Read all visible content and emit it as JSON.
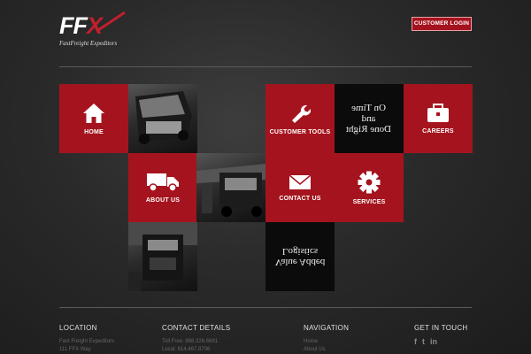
{
  "brand": {
    "logo_text": "FF",
    "logo_x": "X",
    "tagline": "FastFreight Expeditors"
  },
  "header": {
    "login_label": "CUSTOMER LOGIN"
  },
  "tiles": {
    "home": "HOME",
    "customer_tools": "CUSTOMER TOOLS",
    "careers": "CAREERS",
    "about_us": "ABOUT US",
    "contact_us": "CONTACT US",
    "services": "SERVICES",
    "done_right": [
      "On Time",
      "and",
      "Done Right"
    ],
    "value_added": [
      "Value Added",
      "Logistics"
    ]
  },
  "footer": {
    "location": {
      "heading": "LOCATION",
      "lines": [
        "Fast Freight Expeditors",
        "111 FFX Way"
      ]
    },
    "contact": {
      "heading": "CONTACT DETAILS",
      "lines": [
        "Toll Free: 888.328.6691",
        "Local: 814.467.8706"
      ]
    },
    "navigation": {
      "heading": "NAVIGATION",
      "links": [
        "Home",
        "About Us"
      ]
    },
    "social": {
      "heading": "GET IN TOUCH",
      "icons": [
        "f",
        "t",
        "in"
      ]
    }
  },
  "colors": {
    "accent": "#a5141e",
    "background": "#2a2a2a"
  },
  "icons": {
    "home": "house-icon",
    "customer_tools": "wrench-icon",
    "careers": "toolbox-icon",
    "about_us": "truck-icon",
    "contact_us": "envelope-icon",
    "services": "gear-icon"
  }
}
